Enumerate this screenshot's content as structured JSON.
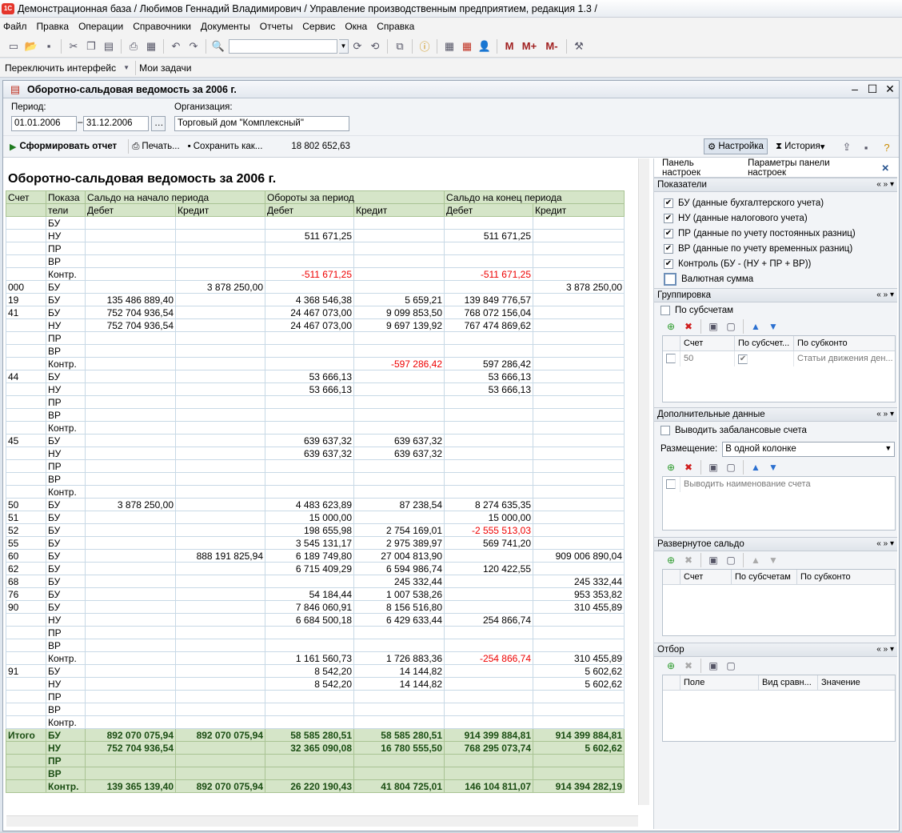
{
  "window": {
    "title": "Демонстрационная база / Любимов Геннадий Владимирович /  Управление производственным предприятием, редакция 1.3 /"
  },
  "menu": [
    "Файл",
    "Правка",
    "Операции",
    "Справочники",
    "Документы",
    "Отчеты",
    "Сервис",
    "Окна",
    "Справка"
  ],
  "toolbar2": {
    "switch_interface": "Переключить интерфейс",
    "my_tasks": "Мои задачи"
  },
  "toolbar_memory": {
    "m": "M",
    "mplus": "M+",
    "mminus": "M-"
  },
  "document": {
    "title": "Оборотно-сальдовая ведомость за 2006 г.",
    "period_label": "Период:",
    "date_from": "01.01.2006",
    "date_to": "31.12.2006",
    "org_label": "Организация:",
    "org_value": "Торговый дом \"Комплексный\"",
    "btn_generate": "Сформировать отчет",
    "btn_print": "Печать...",
    "btn_save": "Сохранить как...",
    "sum_value": "18 802 652,63",
    "btn_settings": "Настройка",
    "btn_history": "История"
  },
  "report": {
    "title": "Оборотно-сальдовая ведомость за 2006 г.",
    "header1": [
      "Счет",
      "Показа",
      "Сальдо на начало периода",
      "Обороты за период",
      "Сальдо на конец периода"
    ],
    "header2": [
      "",
      "тели",
      "Дебет",
      "Кредит",
      "Дебет",
      "Кредит",
      "Дебет",
      "Кредит"
    ],
    "rows": [
      [
        "",
        "БУ",
        "",
        "",
        "",
        "",
        "",
        ""
      ],
      [
        "",
        "НУ",
        "",
        "",
        "511 671,25",
        "",
        "511 671,25",
        ""
      ],
      [
        "",
        "ПР",
        "",
        "",
        "",
        "",
        "",
        ""
      ],
      [
        "",
        "ВР",
        "",
        "",
        "",
        "",
        "",
        ""
      ],
      [
        "",
        "Контр.",
        "",
        "",
        "-511 671,25",
        "",
        "-511 671,25",
        ""
      ],
      [
        "000",
        "БУ",
        "",
        "3 878 250,00",
        "",
        "",
        "",
        "3 878 250,00"
      ],
      [
        "19",
        "БУ",
        "135 486 889,40",
        "",
        "4 368 546,38",
        "5 659,21",
        "139 849 776,57",
        ""
      ],
      [
        "41",
        "БУ",
        "752 704 936,54",
        "",
        "24 467 073,00",
        "9 099 853,50",
        "768 072 156,04",
        ""
      ],
      [
        "",
        "НУ",
        "752 704 936,54",
        "",
        "24 467 073,00",
        "9 697 139,92",
        "767 474 869,62",
        ""
      ],
      [
        "",
        "ПР",
        "",
        "",
        "",
        "",
        "",
        ""
      ],
      [
        "",
        "ВР",
        "",
        "",
        "",
        "",
        "",
        ""
      ],
      [
        "",
        "Контр.",
        "",
        "",
        "",
        "-597 286,42",
        "597 286,42",
        ""
      ],
      [
        "44",
        "БУ",
        "",
        "",
        "53 666,13",
        "",
        "53 666,13",
        ""
      ],
      [
        "",
        "НУ",
        "",
        "",
        "53 666,13",
        "",
        "53 666,13",
        ""
      ],
      [
        "",
        "ПР",
        "",
        "",
        "",
        "",
        "",
        ""
      ],
      [
        "",
        "ВР",
        "",
        "",
        "",
        "",
        "",
        ""
      ],
      [
        "",
        "Контр.",
        "",
        "",
        "",
        "",
        "",
        ""
      ],
      [
        "45",
        "БУ",
        "",
        "",
        "639 637,32",
        "639 637,32",
        "",
        ""
      ],
      [
        "",
        "НУ",
        "",
        "",
        "639 637,32",
        "639 637,32",
        "",
        ""
      ],
      [
        "",
        "ПР",
        "",
        "",
        "",
        "",
        "",
        ""
      ],
      [
        "",
        "ВР",
        "",
        "",
        "",
        "",
        "",
        ""
      ],
      [
        "",
        "Контр.",
        "",
        "",
        "",
        "",
        "",
        ""
      ],
      [
        "50",
        "БУ",
        "3 878 250,00",
        "",
        "4 483 623,89",
        "87 238,54",
        "8 274 635,35",
        ""
      ],
      [
        "51",
        "БУ",
        "",
        "",
        "15 000,00",
        "",
        "15 000,00",
        ""
      ],
      [
        "52",
        "БУ",
        "",
        "",
        "198 655,98",
        "2 754 169,01",
        "-2 555 513,03",
        ""
      ],
      [
        "55",
        "БУ",
        "",
        "",
        "3 545 131,17",
        "2 975 389,97",
        "569 741,20",
        ""
      ],
      [
        "60",
        "БУ",
        "",
        "888 191 825,94",
        "6 189 749,80",
        "27 004 813,90",
        "",
        "909 006 890,04"
      ],
      [
        "62",
        "БУ",
        "",
        "",
        "6 715 409,29",
        "6 594 986,74",
        "120 422,55",
        ""
      ],
      [
        "68",
        "БУ",
        "",
        "",
        "",
        "245 332,44",
        "",
        "245 332,44"
      ],
      [
        "76",
        "БУ",
        "",
        "",
        "54 184,44",
        "1 007 538,26",
        "",
        "953 353,82"
      ],
      [
        "90",
        "БУ",
        "",
        "",
        "7 846 060,91",
        "8 156 516,80",
        "",
        "310 455,89"
      ],
      [
        "",
        "НУ",
        "",
        "",
        "6 684 500,18",
        "6 429 633,44",
        "254 866,74",
        ""
      ],
      [
        "",
        "ПР",
        "",
        "",
        "",
        "",
        "",
        ""
      ],
      [
        "",
        "ВР",
        "",
        "",
        "",
        "",
        "",
        ""
      ],
      [
        "",
        "Контр.",
        "",
        "",
        "1 161 560,73",
        "1 726 883,36",
        "-254 866,74",
        "310 455,89"
      ],
      [
        "91",
        "БУ",
        "",
        "",
        "8 542,20",
        "14 144,82",
        "",
        "5 602,62"
      ],
      [
        "",
        "НУ",
        "",
        "",
        "8 542,20",
        "14 144,82",
        "",
        "5 602,62"
      ],
      [
        "",
        "ПР",
        "",
        "",
        "",
        "",
        "",
        ""
      ],
      [
        "",
        "ВР",
        "",
        "",
        "",
        "",
        "",
        ""
      ],
      [
        "",
        "Контр.",
        "",
        "",
        "",
        "",
        "",
        ""
      ]
    ],
    "totals": [
      [
        "Итого",
        "БУ",
        "892 070 075,94",
        "892 070 075,94",
        "58 585 280,51",
        "58 585 280,51",
        "914 399 884,81",
        "914 399 884,81"
      ],
      [
        "",
        "НУ",
        "752 704 936,54",
        "",
        "32 365 090,08",
        "16 780 555,50",
        "768 295 073,74",
        "5 602,62"
      ],
      [
        "",
        "ПР",
        "",
        "",
        "",
        "",
        "",
        ""
      ],
      [
        "",
        "ВР",
        "",
        "",
        "",
        "",
        "",
        ""
      ],
      [
        "",
        "Контр.",
        "139 365 139,40",
        "892 070 075,94",
        "26 220 190,43",
        "41 804 725,01",
        "146 104 811,07",
        "914 394 282,19"
      ]
    ]
  },
  "panel": {
    "tab1": "Панель настроек",
    "tab2": "Параметры панели настроек",
    "sec_indicators": "Показатели",
    "indicators": [
      {
        "label": "БУ (данные бухгалтерского учета)",
        "checked": true
      },
      {
        "label": "НУ (данные налогового учета)",
        "checked": true
      },
      {
        "label": "ПР (данные по учету постоянных разниц)",
        "checked": true
      },
      {
        "label": "ВР (данные по учету временных разниц)",
        "checked": true
      },
      {
        "label": "Контроль (БУ - (НУ + ПР + ВР))",
        "checked": true
      },
      {
        "label": "Валютная сумма",
        "checked": false
      }
    ],
    "sec_grouping": "Группировка",
    "by_subaccounts": "По субсчетам",
    "grouping_cols": [
      "Счет",
      "По субсчет...",
      "По субконто"
    ],
    "grouping_row": [
      "50",
      "",
      "Статьи движения ден..."
    ],
    "sec_additional": "Дополнительные данные",
    "offbalance": "Выводить забалансовые счета",
    "placement_label": "Размещение:",
    "placement_value": "В одной колонке",
    "show_account_name": "Выводить наименование счета",
    "sec_expanded": "Развернутое сальдо",
    "expanded_cols": [
      "Счет",
      "По субсчетам",
      "По субконто"
    ],
    "sec_filter": "Отбор",
    "filter_cols": [
      "Поле",
      "Вид сравн...",
      "Значение"
    ]
  }
}
